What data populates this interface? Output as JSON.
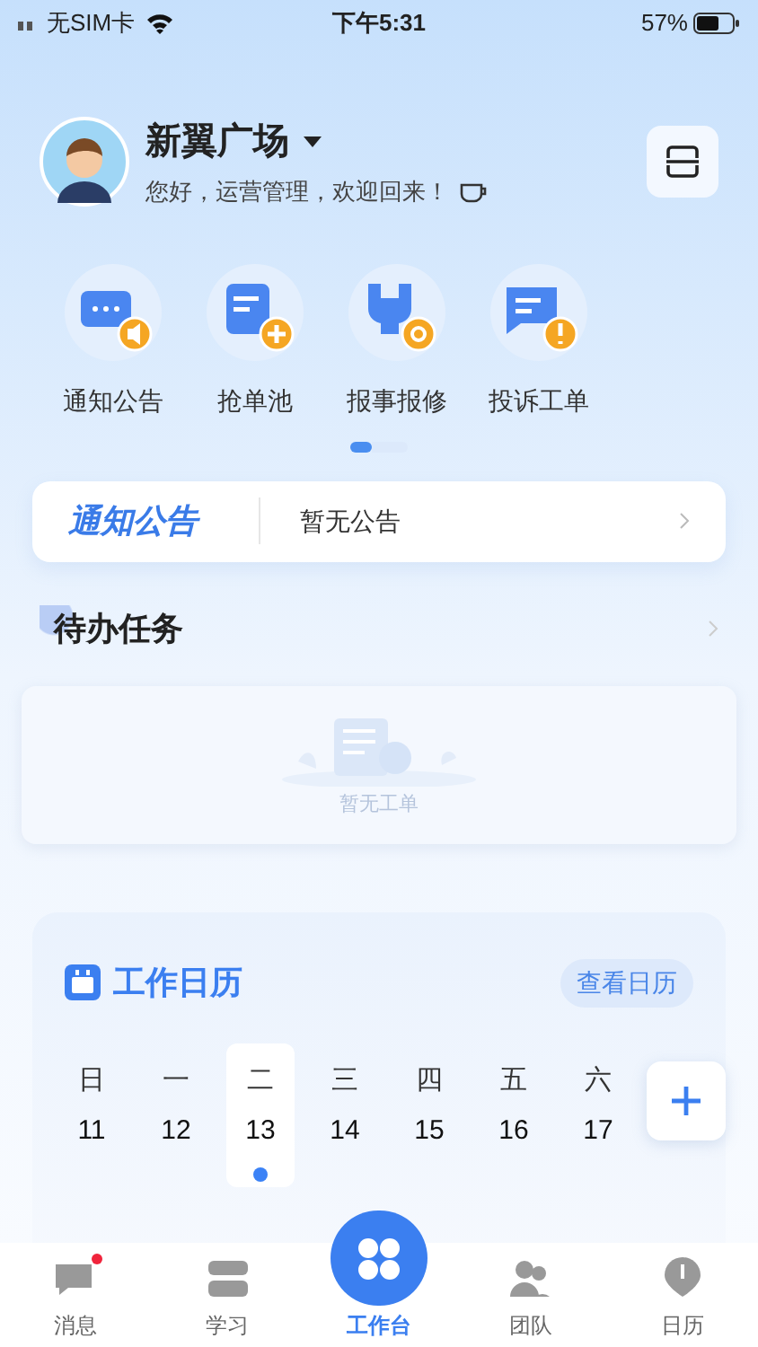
{
  "status_bar": {
    "carrier": "无SIM卡",
    "time": "下午5:31",
    "battery": "57%"
  },
  "header": {
    "project": "新翼广场",
    "greeting": "您好，运营管理，欢迎回来！"
  },
  "shortcuts": [
    {
      "label": "通知公告",
      "kind": "notice"
    },
    {
      "label": "抢单池",
      "kind": "grab"
    },
    {
      "label": "报事报修",
      "kind": "repair"
    },
    {
      "label": "投诉工单",
      "kind": "complaint"
    }
  ],
  "pager": [
    {
      "selected": true
    },
    {
      "selected": false
    }
  ],
  "notice_bar": {
    "title": "通知公告",
    "text": "暂无公告"
  },
  "todo": {
    "title": "待办任务",
    "empty_text": "暂无工单"
  },
  "calendar": {
    "title": "工作日历",
    "link": "查看日历",
    "days": [
      {
        "weekday": "日",
        "date": "11",
        "selected": false,
        "has_event": false
      },
      {
        "weekday": "一",
        "date": "12",
        "selected": false,
        "has_event": false
      },
      {
        "weekday": "二",
        "date": "13",
        "selected": true,
        "has_event": true
      },
      {
        "weekday": "三",
        "date": "14",
        "selected": false,
        "has_event": false
      },
      {
        "weekday": "四",
        "date": "15",
        "selected": false,
        "has_event": false
      },
      {
        "weekday": "五",
        "date": "16",
        "selected": false,
        "has_event": false
      },
      {
        "weekday": "六",
        "date": "17",
        "selected": false,
        "has_event": false
      }
    ]
  },
  "tab_bar": [
    {
      "label": "消息",
      "kind": "message",
      "selected": false,
      "badge": true
    },
    {
      "label": "学习",
      "kind": "study",
      "selected": false,
      "badge": false
    },
    {
      "label": "工作台",
      "kind": "workbench",
      "selected": true,
      "badge": false
    },
    {
      "label": "团队",
      "kind": "team",
      "selected": false,
      "badge": false
    },
    {
      "label": "日历",
      "kind": "calendar",
      "selected": false,
      "badge": false
    }
  ]
}
